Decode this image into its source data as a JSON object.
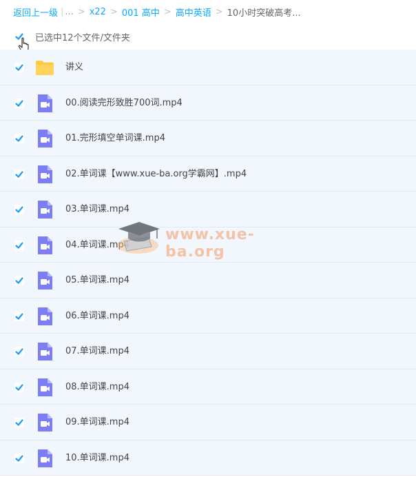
{
  "breadcrumb": {
    "back_label": "返回上一级",
    "ellipsis": "...",
    "items": [
      "x22",
      "001 高中",
      "高中英语"
    ],
    "current": "10小时突破高考..."
  },
  "selection": {
    "label": "已选中12个文件/文件夹",
    "checked": true
  },
  "files": [
    {
      "name": "讲义",
      "type": "folder",
      "checked": true
    },
    {
      "name": "00.阅读完形致胜700词.mp4",
      "type": "video",
      "checked": true
    },
    {
      "name": "01.完形填空单词课.mp4",
      "type": "video",
      "checked": true
    },
    {
      "name": "02.单词课【www.xue-ba.org学霸网】.mp4",
      "type": "video",
      "checked": true
    },
    {
      "name": "03.单词课.mp4",
      "type": "video",
      "checked": true
    },
    {
      "name": "04.单词课.mp4",
      "type": "video",
      "checked": true
    },
    {
      "name": "05.单词课.mp4",
      "type": "video",
      "checked": true
    },
    {
      "name": "06.单词课.mp4",
      "type": "video",
      "checked": true
    },
    {
      "name": "07.单词课.mp4",
      "type": "video",
      "checked": true
    },
    {
      "name": "08.单词课.mp4",
      "type": "video",
      "checked": true
    },
    {
      "name": "09.单词课.mp4",
      "type": "video",
      "checked": true
    },
    {
      "name": "10.单词课.mp4",
      "type": "video",
      "checked": true
    }
  ],
  "watermark": {
    "text": "www.xue-ba.org"
  },
  "icons": {
    "folder": "folder-icon",
    "video": "video-file-icon",
    "check": "checkbox-checked-icon"
  },
  "colors": {
    "link": "#09AAFF",
    "checkbox": "#1A9DF5",
    "row_bg": "#F1F7FD",
    "video_icon": "#7E7EF4",
    "folder_icon": "#FFC940"
  }
}
